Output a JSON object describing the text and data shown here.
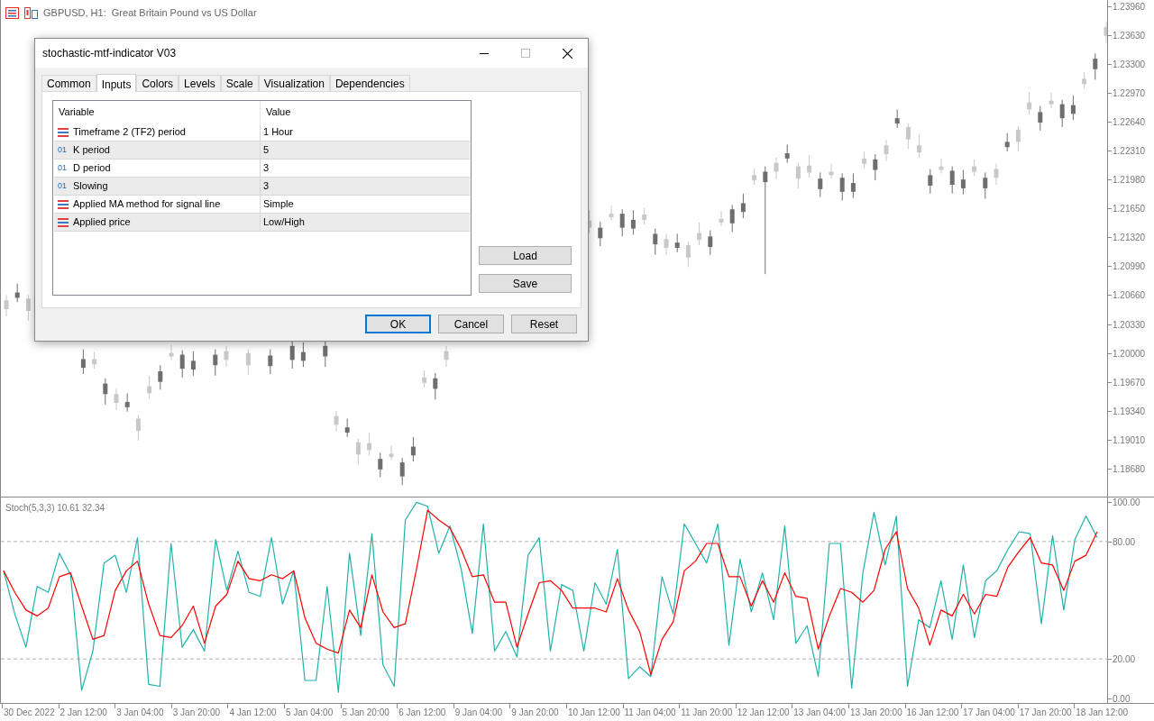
{
  "chart_window": {
    "symbol_title": "GBPUSD, H1:  Great Britain Pound vs US Dollar"
  },
  "price_chart": {
    "chart_data": {
      "type": "candlestick",
      "ylim": [
        1.1837,
        1.2403
      ],
      "yticks": [
        {
          "value": 1.2396,
          "label": "1.23960"
        },
        {
          "value": 1.2363,
          "label": "1.23630"
        },
        {
          "value": 1.233,
          "label": "1.23300"
        },
        {
          "value": 1.2297,
          "label": "1.22970"
        },
        {
          "value": 1.2264,
          "label": "1.22640"
        },
        {
          "value": 1.2231,
          "label": "1.22310"
        },
        {
          "value": 1.2198,
          "label": "1.21980"
        },
        {
          "value": 1.2165,
          "label": "1.21650"
        },
        {
          "value": 1.2132,
          "label": "1.21320"
        },
        {
          "value": 1.2099,
          "label": "1.20990"
        },
        {
          "value": 1.2066,
          "label": "1.20660"
        },
        {
          "value": 1.2033,
          "label": "1.20330"
        },
        {
          "value": 1.2,
          "label": "1.20000"
        },
        {
          "value": 1.1967,
          "label": "1.19670"
        },
        {
          "value": 1.1934,
          "label": "1.19340"
        },
        {
          "value": 1.1901,
          "label": "1.19010"
        },
        {
          "value": 1.1868,
          "label": "1.18680"
        }
      ],
      "ohlc": [
        [
          1.205,
          1.2066,
          1.2042,
          1.206
        ],
        [
          1.2069,
          1.2079,
          1.2058,
          1.2063
        ],
        [
          1.2048,
          1.2066,
          1.2037,
          1.2062
        ],
        null,
        null,
        null,
        null,
        [
          1.1993,
          1.2004,
          1.1976,
          1.1983
        ],
        [
          1.1987,
          1.2001,
          1.1982,
          1.1993
        ],
        [
          1.1965,
          1.1971,
          1.1941,
          1.1953
        ],
        [
          1.1943,
          1.1959,
          1.1935,
          1.1953
        ],
        [
          1.1944,
          1.1954,
          1.1933,
          1.1938
        ],
        [
          1.1911,
          1.1929,
          1.19,
          1.1925
        ],
        [
          1.1954,
          1.1974,
          1.1948,
          1.1962
        ],
        [
          1.1979,
          1.1986,
          1.1958,
          1.1967
        ],
        [
          1.1996,
          1.2009,
          1.1992,
          1.2
        ],
        [
          1.1998,
          1.2003,
          1.1972,
          1.1982
        ],
        [
          1.1991,
          1.2002,
          1.1974,
          1.1981
        ],
        null,
        [
          1.1998,
          1.2004,
          1.1974,
          1.1986
        ],
        [
          1.1992,
          1.2008,
          1.1984,
          1.2002
        ],
        null,
        [
          1.1986,
          1.2004,
          1.1975,
          1.2
        ],
        null,
        [
          1.1997,
          1.2004,
          1.1976,
          1.1985
        ],
        null,
        [
          1.2008,
          1.2013,
          1.1982,
          1.1992
        ],
        [
          1.2001,
          1.2012,
          1.1984,
          1.1991
        ],
        null,
        [
          1.2008,
          1.2014,
          1.1984,
          1.1996
        ],
        [
          1.1918,
          1.1934,
          1.191,
          1.1928
        ],
        [
          1.1915,
          1.1925,
          1.1904,
          1.1909
        ],
        [
          1.1884,
          1.1902,
          1.1873,
          1.1898
        ],
        [
          1.1889,
          1.1909,
          1.1883,
          1.1897
        ],
        [
          1.1879,
          1.1886,
          1.1858,
          1.1867
        ],
        [
          1.1881,
          1.1894,
          1.1877,
          1.1885
        ],
        [
          1.1875,
          1.188,
          1.1849,
          1.1859
        ],
        [
          1.1893,
          1.1904,
          1.1876,
          1.1883
        ],
        [
          1.1966,
          1.198,
          1.1961,
          1.1972
        ],
        [
          1.1971,
          1.1977,
          1.1947,
          1.1959
        ],
        [
          1.1992,
          1.2008,
          1.1984,
          1.2002
        ],
        null,
        null,
        null,
        null,
        null,
        null,
        null,
        null,
        null,
        null,
        null,
        null,
        [
          1.2143,
          1.2163,
          1.2137,
          1.2151
        ],
        [
          1.2143,
          1.215,
          1.2122,
          1.2131
        ],
        [
          1.2155,
          1.2168,
          1.2151,
          1.2159
        ],
        [
          1.2159,
          1.2164,
          1.2133,
          1.2143
        ],
        [
          1.2152,
          1.2163,
          1.2135,
          1.2142
        ],
        [
          1.2152,
          1.2166,
          1.2147,
          1.2158
        ],
        [
          1.2136,
          1.2142,
          1.2112,
          1.2124
        ],
        [
          1.212,
          1.2136,
          1.2112,
          1.213
        ],
        [
          1.2126,
          1.2136,
          1.2115,
          1.212
        ],
        [
          1.2109,
          1.2127,
          1.2098,
          1.2123
        ],
        [
          1.2129,
          1.2149,
          1.2123,
          1.2137
        ],
        [
          1.2133,
          1.214,
          1.2112,
          1.2121
        ],
        [
          1.2149,
          1.2162,
          1.2145,
          1.2153
        ],
        [
          1.2164,
          1.2169,
          1.2138,
          1.2148
        ],
        [
          1.2171,
          1.2182,
          1.2154,
          1.2161
        ],
        [
          1.2197,
          1.2211,
          1.2192,
          1.2203
        ],
        [
          1.2207,
          1.2213,
          1.209,
          1.2195
        ],
        [
          1.2207,
          1.2223,
          1.2199,
          1.2217
        ],
        [
          1.2228,
          1.2238,
          1.2217,
          1.2222
        ],
        [
          1.2199,
          1.2217,
          1.2188,
          1.2213
        ],
        [
          1.2206,
          1.2226,
          1.22,
          1.2214
        ],
        [
          1.2199,
          1.2206,
          1.2178,
          1.2187
        ],
        [
          1.2203,
          1.2216,
          1.2199,
          1.2207
        ],
        [
          1.22,
          1.2205,
          1.2174,
          1.2184
        ],
        [
          1.2194,
          1.2205,
          1.2177,
          1.2184
        ],
        [
          1.2216,
          1.223,
          1.2211,
          1.2222
        ],
        [
          1.2221,
          1.2227,
          1.2197,
          1.2209
        ],
        [
          1.2227,
          1.2243,
          1.2219,
          1.2237
        ],
        [
          1.2268,
          1.2278,
          1.2257,
          1.2262
        ],
        [
          1.2244,
          1.2262,
          1.2233,
          1.2258
        ],
        [
          1.2229,
          1.2249,
          1.2223,
          1.2237
        ],
        [
          1.2203,
          1.221,
          1.2182,
          1.2191
        ],
        [
          1.2209,
          1.2222,
          1.2205,
          1.2213
        ],
        [
          1.2208,
          1.2213,
          1.2182,
          1.2192
        ],
        [
          1.2198,
          1.2209,
          1.2181,
          1.2188
        ],
        [
          1.2207,
          1.2221,
          1.2202,
          1.2213
        ],
        [
          1.22,
          1.2206,
          1.2176,
          1.2188
        ],
        [
          1.22,
          1.2216,
          1.2192,
          1.221
        ],
        [
          1.2241,
          1.2251,
          1.223,
          1.2235
        ],
        [
          1.2241,
          1.2259,
          1.223,
          1.2255
        ],
        [
          1.2278,
          1.2298,
          1.2272,
          1.2286
        ],
        [
          1.2275,
          1.2282,
          1.2254,
          1.2263
        ],
        [
          1.2284,
          1.2297,
          1.228,
          1.2288
        ],
        [
          1.2284,
          1.2289,
          1.2258,
          1.2268
        ],
        [
          1.2283,
          1.2294,
          1.2266,
          1.2273
        ],
        [
          1.2307,
          1.2321,
          1.2302,
          1.2313
        ],
        [
          1.2336,
          1.2342,
          1.2312,
          1.2324
        ],
        [
          1.2362,
          1.2378,
          1.2354,
          1.2372
        ]
      ]
    }
  },
  "stochastic_pane": {
    "indicator_label": "Stoch(5,3,3) 10.61 32.34",
    "chart_data": {
      "type": "line",
      "grid": true,
      "ylim": [
        -2.5,
        102.5
      ],
      "yticks": [
        {
          "value": 100,
          "label": "100.00"
        },
        {
          "value": 80,
          "label": "80.00"
        },
        {
          "value": 20,
          "label": "20.00"
        },
        {
          "value": 0,
          "label": "0.00"
        }
      ],
      "series": [
        {
          "color": "#20b2aa",
          "values": [
            65,
            43,
            26,
            57,
            54,
            74,
            63,
            4,
            24,
            69,
            73,
            54,
            82,
            7,
            6,
            79,
            26,
            35,
            24,
            81,
            55,
            75,
            54,
            52,
            82,
            48,
            65,
            9,
            9,
            57,
            3,
            74,
            32,
            84,
            17,
            6,
            91,
            100,
            98,
            74,
            88,
            66,
            33,
            89,
            24,
            34,
            21,
            73,
            82,
            24,
            58,
            55,
            24,
            59,
            48,
            76,
            10,
            16,
            11,
            62,
            43,
            89,
            79,
            69,
            89,
            27,
            71,
            44,
            64,
            40,
            88,
            28,
            37,
            11,
            79,
            79,
            5,
            64,
            95,
            68,
            93,
            6,
            40,
            36,
            60,
            30,
            68,
            31,
            60,
            65,
            76,
            85,
            84,
            38,
            83,
            45,
            81,
            93,
            82
          ]
        },
        {
          "color": "#ff0000",
          "values": [
            65,
            54,
            45,
            42,
            46,
            62,
            64,
            47,
            30,
            32,
            55,
            65,
            70,
            48,
            32,
            31,
            37,
            47,
            28,
            47,
            53,
            70,
            61,
            60,
            63,
            61,
            65,
            41,
            28,
            25,
            23,
            45,
            36,
            63,
            44,
            36,
            38,
            66,
            96,
            91,
            87,
            76,
            62,
            63,
            49,
            49,
            26,
            43,
            59,
            60,
            55,
            46,
            46,
            46,
            44,
            61,
            45,
            34,
            12,
            30,
            39,
            65,
            70,
            79,
            79,
            62,
            62,
            47,
            60,
            49,
            64,
            52,
            51,
            25,
            42,
            56,
            54,
            49,
            55,
            76,
            85,
            56,
            46,
            27,
            45,
            42,
            53,
            43,
            53,
            52,
            67,
            75,
            82,
            69,
            68,
            55,
            70,
            73,
            85
          ]
        }
      ]
    }
  },
  "time_axis": [
    "30 Dec 2022",
    "2 Jan 12:00",
    "3 Jan 04:00",
    "3 Jan 20:00",
    "4 Jan 12:00",
    "5 Jan 04:00",
    "5 Jan 20:00",
    "6 Jan 12:00",
    "9 Jan 04:00",
    "9 Jan 20:00",
    "10 Jan 12:00",
    "11 Jan 04:00",
    "11 Jan 20:00",
    "12 Jan 12:00",
    "13 Jan 04:00",
    "13 Jan 20:00",
    "16 Jan 12:00",
    "17 Jan 04:00",
    "17 Jan 20:00",
    "18 Jan 12:00"
  ],
  "dialog": {
    "title": "stochastic-mtf-indicator V03",
    "tabs": [
      {
        "label": "Common",
        "selected": false
      },
      {
        "label": "Inputs",
        "selected": true
      },
      {
        "label": "Colors",
        "selected": false
      },
      {
        "label": "Levels",
        "selected": false
      },
      {
        "label": "Scale",
        "selected": false
      },
      {
        "label": "Visualization",
        "selected": false
      },
      {
        "label": "Dependencies",
        "selected": false
      }
    ],
    "table": {
      "columns": [
        "Variable",
        "Value"
      ],
      "rows": [
        {
          "kind": "enum",
          "variable": "Timeframe 2 (TF2) period",
          "value": "1 Hour"
        },
        {
          "kind": "int",
          "icon_text": "01",
          "variable": "K period",
          "value": "5"
        },
        {
          "kind": "int",
          "icon_text": "01",
          "variable": "D period",
          "value": "3"
        },
        {
          "kind": "int",
          "icon_text": "01",
          "variable": "Slowing",
          "value": "3"
        },
        {
          "kind": "enum",
          "variable": "Applied MA method for signal line",
          "value": "Simple"
        },
        {
          "kind": "enum",
          "variable": "Applied price",
          "value": "Low/High"
        }
      ]
    },
    "side_buttons": [
      "Load",
      "Save"
    ],
    "footer_buttons": [
      {
        "label": "OK",
        "default": true
      },
      {
        "label": "Cancel",
        "default": false
      },
      {
        "label": "Reset",
        "default": false
      }
    ]
  }
}
